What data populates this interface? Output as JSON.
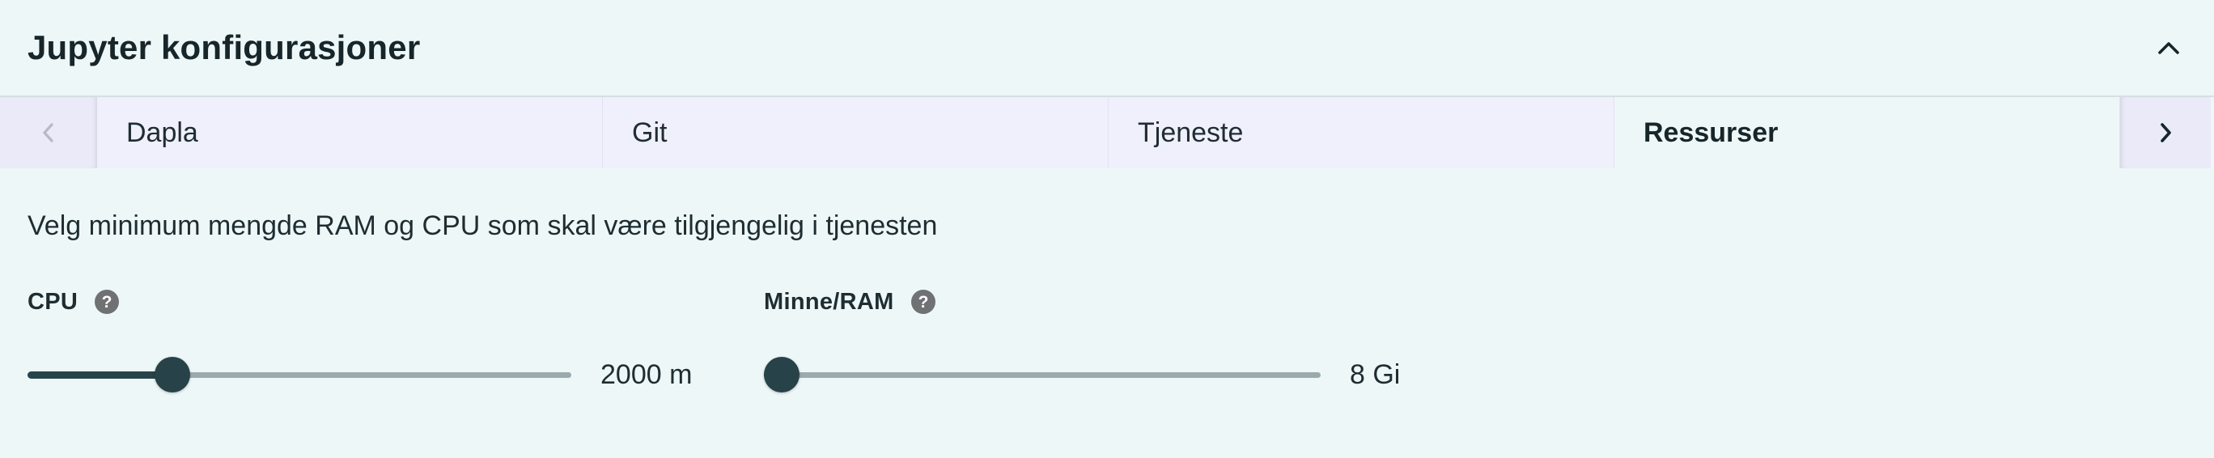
{
  "panel": {
    "title": "Jupyter konfigurasjoner",
    "collapse_icon": "chevron-up-icon"
  },
  "tabs": {
    "prev_icon": "chevron-left-icon",
    "next_icon": "chevron-right-icon",
    "items": [
      {
        "label": "Dapla",
        "active": false
      },
      {
        "label": "Git",
        "active": false
      },
      {
        "label": "Tjeneste",
        "active": false
      },
      {
        "label": "Ressurser",
        "active": true
      }
    ]
  },
  "resources": {
    "description": "Velg minimum mengde RAM og CPU som skal være tilgjengelig i tjenesten",
    "cpu": {
      "label": "CPU",
      "help_icon": "help-circle-icon",
      "value_text": "2000 m",
      "slider_fraction": 0.25
    },
    "ram": {
      "label": "Minne/RAM",
      "help_icon": "help-circle-icon",
      "value_text": "8 Gi",
      "slider_fraction": 0.0
    }
  },
  "colors": {
    "background": "#eef7f8",
    "tab_background": "#f0effc",
    "slider_active": "#27444a",
    "slider_rail": "#9aaaad",
    "text": "#1e2d31"
  }
}
